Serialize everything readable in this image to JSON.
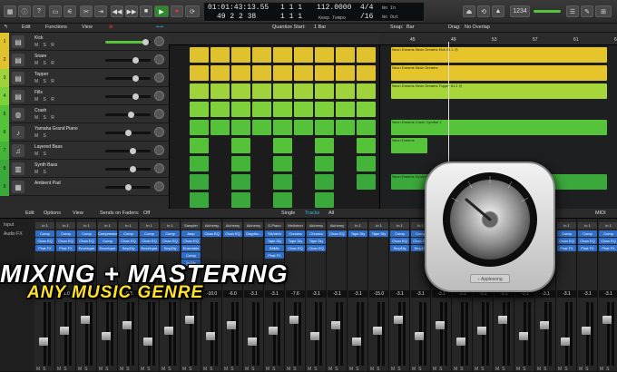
{
  "lcd": {
    "time": "01:01:43:13.55",
    "bars": "49  2  2  38",
    "pos1": "1  1  1",
    "pos2": "1  1  1",
    "tempo": "112.0000",
    "keep_tempo": "Keep Tempo",
    "sig_top": "4/4",
    "sig_bottom": "/16",
    "in_label": "No In",
    "out_label": "No Out"
  },
  "menubar": {
    "edit": "Edit",
    "functions": "Functions",
    "view": "View",
    "quantize": "Quantize Start:",
    "quantize_value": "1 Bar",
    "snap": "Snap:",
    "snap_value": "Bar",
    "drag": "Drag:",
    "drag_value": "No Overlap"
  },
  "ruler": [
    "45",
    "49",
    "53",
    "57",
    "61",
    "65"
  ],
  "tracks": [
    {
      "num": "1",
      "name": "Kick",
      "ms": "M S R",
      "color": "#e0c12e",
      "fader": 0.88,
      "icon": "▤"
    },
    {
      "num": "2",
      "name": "Snare",
      "ms": "M S R",
      "color": "#e0c12e",
      "fader": 0.66,
      "icon": "▤"
    },
    {
      "num": "3",
      "name": "Topper",
      "ms": "M S R",
      "color": "#9fd33c",
      "fader": 0.66,
      "icon": "▤"
    },
    {
      "num": "4",
      "name": "Fills",
      "ms": "M S R",
      "color": "#7fd13b",
      "fader": 0.66,
      "icon": "▤"
    },
    {
      "num": "5",
      "name": "Crash",
      "ms": "M S R",
      "color": "#56c23a",
      "fader": 0.55,
      "icon": "◍"
    },
    {
      "num": "6",
      "name": "Yamaha Grand Piano",
      "ms": "M S",
      "color": "#56c23a",
      "fader": 0.5,
      "icon": "♪"
    },
    {
      "num": "7",
      "name": "Layered Bass",
      "ms": "M S",
      "color": "#45b53a",
      "fader": 0.6,
      "icon": "♫"
    },
    {
      "num": "8",
      "name": "Synth Bass",
      "ms": "M S",
      "color": "#3aa83a",
      "fader": 0.6,
      "icon": "▥"
    },
    {
      "num": "9",
      "name": "Ambient Pad",
      "ms": "",
      "color": "#3aa83a",
      "fader": 0.5,
      "icon": "▦"
    }
  ],
  "regions_right": [
    {
      "track": 0,
      "label": "Neon Dreams  Neon Dreams Kick 61.1 ◎",
      "label2": "Neon Dreams Kick 61.1",
      "color": "#e6c52c"
    },
    {
      "track": 1,
      "label": "Neon Dreams  Neon Dreams",
      "color": "#e6c52c"
    },
    {
      "track": 2,
      "label": "Neon Dreams  Neon Dreams Topper 61.1 ◎",
      "color": "#a6d63a"
    },
    {
      "track": 4,
      "label": "Neon Dreams Crash Cymbal 1",
      "color": "#56c43a"
    },
    {
      "track": 5,
      "label": "Neon Dreams",
      "color": "#56c43a"
    },
    {
      "track": 7,
      "label": "Neon Dreams Synth Bass",
      "color": "#3aa83a"
    }
  ],
  "mixer": {
    "edit": "Edit",
    "options": "Options",
    "view": "View",
    "sends": "Sends on Faders:",
    "sends_value": "Off",
    "single": "Single",
    "tracks": "Tracks",
    "all": "All",
    "midi": "MIDI",
    "input_label": "Input",
    "audiofx_label": "Audio FX",
    "strips": [
      {
        "cap": "In 1",
        "plugs": [
          "Comp",
          "Chan EQ",
          "Phat FX"
        ],
        "vol": "-3.1"
      },
      {
        "cap": "In 1",
        "plugs": [
          "Comp",
          "Chan EQ",
          "Phat FX"
        ],
        "vol": "-1.0"
      },
      {
        "cap": "In 1",
        "plugs": [
          "Comp",
          "Chan EQ",
          "Enveloper"
        ],
        "vol": "-3.1"
      },
      {
        "cap": "In 1",
        "plugs": [
          "Compressor",
          "Comp",
          "Enveloper"
        ],
        "vol": "-0.1"
      },
      {
        "cap": "In 1",
        "plugs": [
          "Comp",
          "Chan EQ",
          "SmpDly"
        ],
        "vol": "-6.3"
      },
      {
        "cap": "In 1",
        "plugs": [
          "Comp",
          "Chan EQ",
          "Enveloper"
        ],
        "vol": "-3.1"
      },
      {
        "cap": "In 1",
        "plugs": [
          "Comp",
          "Chan EQ",
          "SmpDly"
        ],
        "vol": "-3.1"
      },
      {
        "cap": "Sampler",
        "plugs": [
          "Amp",
          "Chan EQ",
          "Ensemble",
          "Comp",
          "In Dly"
        ],
        "vol": "-3.1"
      },
      {
        "cap": "Alchemy",
        "plugs": [
          "Chan EQ"
        ],
        "vol": "-10.0"
      },
      {
        "cap": "Alchemy",
        "plugs": [
          "Chan EQ"
        ],
        "vol": "-6.0"
      },
      {
        "cap": "Alchemy",
        "plugs": [
          "Graphic..."
        ],
        "vol": "-3.1"
      },
      {
        "cap": "E-Piano",
        "plugs": [
          "SilvVerb",
          "Tape Dly",
          "BitMix",
          "Phat FX"
        ],
        "vol": "-3.1"
      },
      {
        "cap": "Mellotron",
        "plugs": [
          "Chroma",
          "Tape Dly",
          "Chan EQ"
        ],
        "vol": "-7.6"
      },
      {
        "cap": "Alchemy",
        "plugs": [
          "Chroma",
          "Tape Dly",
          "Chan EQ"
        ],
        "vol": "-3.1"
      },
      {
        "cap": "Alchemy",
        "plugs": [
          "Chan EQ"
        ],
        "vol": "-3.1"
      },
      {
        "cap": "In 1",
        "plugs": [
          "Tape Dly"
        ],
        "vol": "-3.1"
      },
      {
        "cap": "In 1",
        "plugs": [
          "Tape Dly"
        ],
        "vol": "-15.0"
      },
      {
        "cap": "In 1",
        "plugs": [
          "Comp",
          "Chan EQ",
          "SmpDly"
        ],
        "vol": "-3.1"
      },
      {
        "cap": "In 1",
        "plugs": [
          "Comp",
          "Chan EQ",
          "SmpDly"
        ],
        "vol": "-3.1"
      },
      {
        "cap": "In 1",
        "plugs": [],
        "vol": "-3.1"
      },
      {
        "cap": "In 1",
        "plugs": [],
        "vol": "-3.1"
      },
      {
        "cap": "In 1",
        "plugs": [],
        "vol": "-3.1"
      },
      {
        "cap": "In 1",
        "plugs": [],
        "vol": "-3.1"
      },
      {
        "cap": "In 1",
        "plugs": [],
        "vol": "-3.1"
      },
      {
        "cap": "In 1",
        "plugs": [],
        "vol": "-3.1"
      },
      {
        "cap": "In 1",
        "plugs": [
          "Comp",
          "Chan EQ",
          "Phat FX"
        ],
        "vol": "-3.1"
      },
      {
        "cap": "In 1",
        "plugs": [
          "Comp",
          "Chan EQ",
          "Phat FX"
        ],
        "vol": "-3.1"
      },
      {
        "cap": "In 1",
        "plugs": [
          "Comp",
          "Chan EQ",
          "Phat FX"
        ],
        "vol": "-3.1"
      }
    ]
  },
  "overlay": {
    "line1": "MIXING + MASTERING",
    "line2": "ANY MUSIC GENRE"
  },
  "logo": {
    "badge": "♪ Applesong"
  }
}
